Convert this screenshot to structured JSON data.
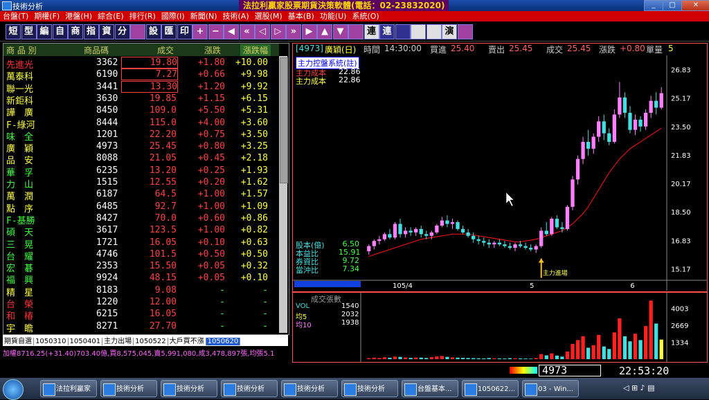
{
  "window": {
    "title": "技術分析",
    "banner": "法拉利贏家股票期貨決策軟體(電話：02-23832020)"
  },
  "menu": [
    "台盤(T)",
    "期權(F)",
    "港盤(H)",
    "綜合(E)",
    "排行(R)",
    "國際(I)",
    "新聞(N)",
    "技術(A)",
    "選股(M)",
    "基本(B)",
    "功能(U)",
    "系統(O)"
  ],
  "toolbar": [
    "短",
    "型",
    "編",
    "自",
    "商",
    "指",
    "資",
    "分",
    "",
    "設",
    "匯",
    "印",
    "+",
    "−",
    "◀",
    "«",
    "◁",
    "▷",
    "»",
    "▶",
    "▲",
    "▼",
    "",
    "連",
    "連",
    "",
    "",
    "",
    "演",
    ""
  ],
  "table": {
    "headers": [
      "商 品 別",
      "商品碼",
      "成交",
      "漲跌",
      "漲跌幅"
    ],
    "rows": [
      {
        "name": "先進光",
        "code": "3362",
        "price": "19.80",
        "chg": "+1.80",
        "pct": "+10.00",
        "color": "#ff3030"
      },
      {
        "name": "萬泰科",
        "code": "6190",
        "price": "7.27",
        "chg": "+0.66",
        "pct": "+9.98",
        "color": "#ffff40"
      },
      {
        "name": "聯一光",
        "code": "3441",
        "price": "13.30",
        "chg": "+1.20",
        "pct": "+9.92",
        "color": "#ffff40"
      },
      {
        "name": "新鉅科",
        "code": "3630",
        "price": "19.85",
        "chg": "+1.15",
        "pct": "+6.15",
        "color": "#ffff40"
      },
      {
        "name": "譁　廣",
        "code": "8450",
        "price": "109.0",
        "chg": "+5.50",
        "pct": "+5.31",
        "color": "#ffff40"
      },
      {
        "name": "F-綠河",
        "code": "8444",
        "price": "115.0",
        "chg": "+4.00",
        "pct": "+3.60",
        "color": "#ffff40"
      },
      {
        "name": "味　全",
        "code": "1201",
        "price": "22.20",
        "chg": "+0.75",
        "pct": "+3.50",
        "color": "#40ff40"
      },
      {
        "name": "廣　穎",
        "code": "4973",
        "price": "25.45",
        "chg": "+0.80",
        "pct": "+3.25",
        "color": "#ffff40"
      },
      {
        "name": "品　安",
        "code": "8088",
        "price": "21.05",
        "chg": "+0.45",
        "pct": "+2.18",
        "color": "#ffff40"
      },
      {
        "name": "華　孚",
        "code": "6235",
        "price": "13.20",
        "chg": "+0.25",
        "pct": "+1.93",
        "color": "#40ff40"
      },
      {
        "name": "力　山",
        "code": "1515",
        "price": "12.55",
        "chg": "+0.20",
        "pct": "+1.62",
        "color": "#40ff40"
      },
      {
        "name": "萬　潤",
        "code": "6187",
        "price": "64.5",
        "chg": "+1.00",
        "pct": "+1.57",
        "color": "#ffff40"
      },
      {
        "name": "點　序",
        "code": "6485",
        "price": "92.7",
        "chg": "+1.00",
        "pct": "+1.09",
        "color": "#ffff40"
      },
      {
        "name": "F-基勝",
        "code": "8427",
        "price": "70.0",
        "chg": "+0.60",
        "pct": "+0.86",
        "color": "#40ff40"
      },
      {
        "name": "碩　天",
        "code": "3617",
        "price": "123.5",
        "chg": "+1.00",
        "pct": "+0.82",
        "color": "#40ff40"
      },
      {
        "name": "三　晃",
        "code": "1721",
        "price": "16.05",
        "chg": "+0.10",
        "pct": "+0.63",
        "color": "#40ff40"
      },
      {
        "name": "台　耀",
        "code": "4746",
        "price": "101.5",
        "chg": "+0.50",
        "pct": "+0.50",
        "color": "#40ff40"
      },
      {
        "name": "宏　碁",
        "code": "2353",
        "price": "15.50",
        "chg": "+0.05",
        "pct": "+0.32",
        "color": "#40ff40"
      },
      {
        "name": "福　興",
        "code": "9924",
        "price": "48.15",
        "chg": "+0.05",
        "pct": "+0.10",
        "color": "#40ff40"
      },
      {
        "name": "精　星",
        "code": "8183",
        "price": "9.08",
        "chg": "-",
        "pct": "-",
        "color": "#ffff40"
      },
      {
        "name": "台　榮",
        "code": "1220",
        "price": "12.00",
        "chg": "-",
        "pct": "-",
        "color": "#ff3030"
      },
      {
        "name": "和　椿",
        "code": "6215",
        "price": "16.05",
        "chg": "-",
        "pct": "-",
        "color": "#ff3030"
      },
      {
        "name": "宇　瞻",
        "code": "8271",
        "price": "27.70",
        "chg": "-",
        "pct": "-",
        "color": "#ffff40"
      }
    ]
  },
  "tabs": [
    "期貨自選",
    "1050310",
    "1050401",
    "主力出場",
    "1050522",
    "大戶買不漲",
    "1050620"
  ],
  "ticker": "加權8716.25(+31.40)703.40億,買8,575,045,賣5,991,080,成3,478,897張,均張5.1",
  "chart": {
    "header": {
      "code": "[4973]",
      "name": "廣穎(日)",
      "time_label": "時間",
      "time": "14:30:00",
      "bid_label": "買進",
      "bid": "25.40",
      "ask_label": "賣出",
      "ask": "25.45",
      "last_label": "成交",
      "last": "25.45",
      "chg_label": "漲跌",
      "chg": "+0.80",
      "qty_label": "單量",
      "qty": "5"
    },
    "indicator_title": "主力控盤系統(註)",
    "cost1_label": "主力成本",
    "cost1": "22.86",
    "cost2_label": "主力成本",
    "cost2": "22.86",
    "stats": [
      {
        "label": "股本(億)",
        "value": "6.50"
      },
      {
        "label": "本益比",
        "value": "15.91"
      },
      {
        "label": "券資比",
        "value": "9.72"
      },
      {
        "label": "當沖比",
        "value": "7.34"
      }
    ],
    "annotation": "主力進場",
    "colors": {
      "up": "#ff80ff",
      "down": "#40e0e0",
      "ma": "#e01010"
    }
  },
  "chart_data": [
    {
      "type": "candlestick",
      "y_ticks": [
        "26.83",
        "25.17",
        "23.50",
        "21.83",
        "20.17",
        "18.50",
        "16.83",
        "15.17"
      ],
      "ylim": [
        14.5,
        27.5
      ],
      "x_labels": [
        "105/4",
        "5",
        "6"
      ],
      "ohlc": [
        [
          16.2,
          16.6,
          16.0,
          16.5
        ],
        [
          16.5,
          16.9,
          16.3,
          16.8
        ],
        [
          16.8,
          17.1,
          16.6,
          16.9
        ],
        [
          16.9,
          17.3,
          16.8,
          17.2
        ],
        [
          17.2,
          17.5,
          16.9,
          17.0
        ],
        [
          17.0,
          17.9,
          16.9,
          17.8
        ],
        [
          17.8,
          18.1,
          17.0,
          17.2
        ],
        [
          17.2,
          17.6,
          17.0,
          17.4
        ],
        [
          17.4,
          17.6,
          17.1,
          17.3
        ],
        [
          17.3,
          17.6,
          17.1,
          17.5
        ],
        [
          17.5,
          17.7,
          17.0,
          17.2
        ],
        [
          17.2,
          17.4,
          16.9,
          17.1
        ],
        [
          17.1,
          17.4,
          16.9,
          17.3
        ],
        [
          17.3,
          17.8,
          17.2,
          17.7
        ],
        [
          17.7,
          18.2,
          17.6,
          18.0
        ],
        [
          18.0,
          18.3,
          17.6,
          17.8
        ],
        [
          17.8,
          18.1,
          17.5,
          17.9
        ],
        [
          17.9,
          18.0,
          17.4,
          17.5
        ],
        [
          17.5,
          17.7,
          17.2,
          17.3
        ],
        [
          17.3,
          17.5,
          17.0,
          17.1
        ],
        [
          17.1,
          17.3,
          16.7,
          16.9
        ],
        [
          16.9,
          17.1,
          16.6,
          16.8
        ],
        [
          16.8,
          17.0,
          16.5,
          16.7
        ],
        [
          16.7,
          16.9,
          16.4,
          16.6
        ],
        [
          16.6,
          16.8,
          16.4,
          16.7
        ],
        [
          16.7,
          16.9,
          16.5,
          16.6
        ],
        [
          16.6,
          16.8,
          16.4,
          16.5
        ],
        [
          16.5,
          16.7,
          16.3,
          16.4
        ],
        [
          16.4,
          16.7,
          16.2,
          16.6
        ],
        [
          16.6,
          16.8,
          16.4,
          16.5
        ],
        [
          16.5,
          16.7,
          16.3,
          16.4
        ],
        [
          16.4,
          16.6,
          16.2,
          16.3
        ],
        [
          16.3,
          16.6,
          16.1,
          16.5
        ],
        [
          16.5,
          17.6,
          16.4,
          17.4
        ],
        [
          17.4,
          17.9,
          17.1,
          17.2
        ],
        [
          17.2,
          18.2,
          17.1,
          18.1
        ],
        [
          18.1,
          18.3,
          17.5,
          17.6
        ],
        [
          17.6,
          17.9,
          17.3,
          17.5
        ],
        [
          17.5,
          18.9,
          17.4,
          18.8
        ],
        [
          18.8,
          20.6,
          18.6,
          20.4
        ],
        [
          20.4,
          21.8,
          20.1,
          21.6
        ],
        [
          21.6,
          22.9,
          21.3,
          22.6
        ],
        [
          22.6,
          23.3,
          21.8,
          22.2
        ],
        [
          22.2,
          23.1,
          21.9,
          22.9
        ],
        [
          22.9,
          24.1,
          22.6,
          23.8
        ],
        [
          23.8,
          24.2,
          22.7,
          23.1
        ],
        [
          23.1,
          23.4,
          22.4,
          22.6
        ],
        [
          22.6,
          24.5,
          22.5,
          24.2
        ],
        [
          24.2,
          26.1,
          24.0,
          25.2
        ],
        [
          25.2,
          25.5,
          24.0,
          24.3
        ],
        [
          24.3,
          24.7,
          23.1,
          23.3
        ],
        [
          23.3,
          24.2,
          23.0,
          23.9
        ],
        [
          23.9,
          24.1,
          23.2,
          23.5
        ],
        [
          23.5,
          24.5,
          23.3,
          24.3
        ],
        [
          24.3,
          25.3,
          24.0,
          25.0
        ],
        [
          25.0,
          25.5,
          24.2,
          24.6
        ],
        [
          24.6,
          25.8,
          24.5,
          25.45
        ]
      ],
      "ma": [
        15.9,
        16.0,
        16.1,
        16.2,
        16.3,
        16.4,
        16.5,
        16.6,
        16.7,
        16.8,
        16.9,
        16.95,
        17.0,
        17.05,
        17.1,
        17.15,
        17.2,
        17.2,
        17.2,
        17.2,
        17.15,
        17.1,
        17.05,
        17.0,
        16.95,
        16.9,
        16.85,
        16.8,
        16.75,
        16.75,
        16.8,
        16.85,
        16.9,
        17.0,
        17.1,
        17.2,
        17.3,
        17.4,
        17.6,
        17.8,
        18.1,
        18.4,
        18.8,
        19.3,
        19.8,
        20.3,
        20.8,
        21.2,
        21.6,
        21.9,
        22.2,
        22.4,
        22.6,
        22.8,
        23.0,
        23.2,
        23.4
      ]
    },
    {
      "type": "bar",
      "title": "成交張數",
      "vol_label": "VOL",
      "vol": "1540",
      "ma5_label": "均5",
      "ma5": "2032",
      "ma10_label": "均10",
      "ma10": "1938",
      "y_ticks": [
        "4003",
        "2669",
        "1334"
      ],
      "ylim": [
        0,
        5000
      ],
      "values": [
        80,
        120,
        90,
        150,
        110,
        200,
        180,
        140,
        100,
        130,
        120,
        90,
        160,
        210,
        250,
        180,
        140,
        120,
        100,
        90,
        80,
        70,
        60,
        90,
        70,
        60,
        50,
        80,
        70,
        60,
        50,
        40,
        90,
        400,
        300,
        450,
        280,
        200,
        600,
        1200,
        1500,
        1800,
        900,
        1100,
        1900,
        1000,
        800,
        2100,
        3200,
        1800,
        1400,
        2000,
        1500,
        2600,
        4600,
        2800,
        1540
      ]
    }
  ],
  "status": {
    "code": "4973",
    "time": "22:53:20"
  },
  "taskbar": {
    "tasks": [
      "法拉利贏家",
      "技術分析",
      "技術分析",
      "技術分析",
      "技術分析",
      "技術分析",
      "台盤基本...",
      "1050622...",
      "03 - Win..."
    ]
  }
}
